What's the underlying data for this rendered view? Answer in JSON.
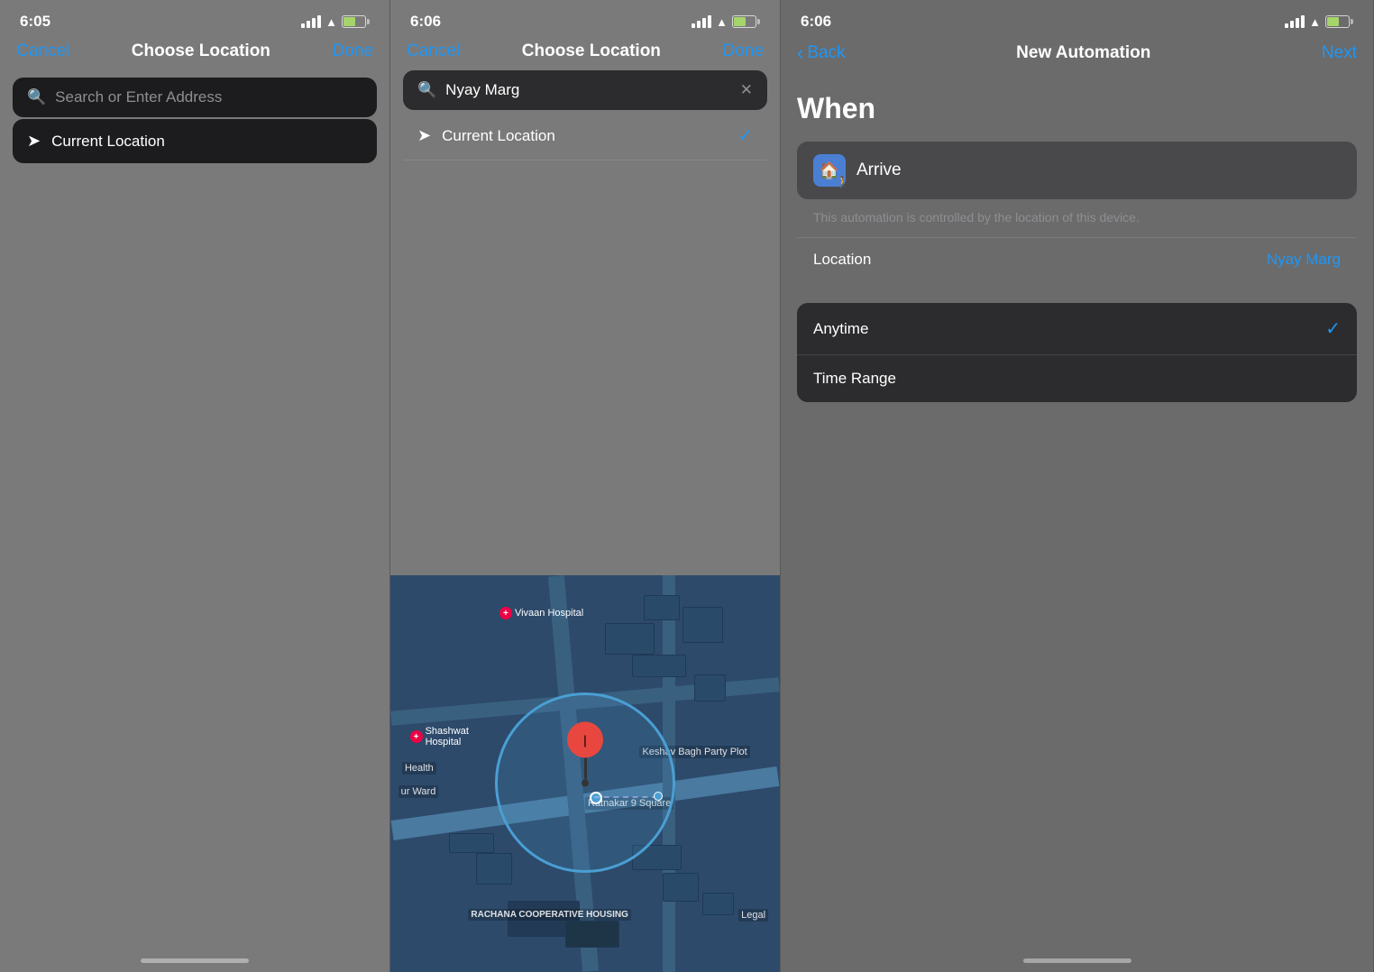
{
  "panel1": {
    "status_time": "6:05",
    "nav_cancel": "Cancel",
    "nav_title": "Choose Location",
    "nav_done": "Done",
    "search_placeholder": "Search or Enter Address",
    "current_location": "Current Location"
  },
  "panel2": {
    "status_time": "6:06",
    "nav_cancel": "Cancel",
    "nav_title": "Choose Location",
    "nav_done": "Done",
    "search_value": "Nyay Marg",
    "current_location": "Current Location",
    "map_labels": {
      "hospital1": "Vivaan Hospital",
      "hospital2": "Shashwat Hospital",
      "health": "Health",
      "ward": "ur Ward",
      "keshav": "Keshav Bagh Party Plot",
      "ratnakar": "Ratnakar 9 Square",
      "rachana": "RACHANA COOPERATIVE HOUSING",
      "legal": "Legal"
    }
  },
  "panel3": {
    "status_time": "6:06",
    "back_label": "Back",
    "title": "New Automation",
    "next_label": "Next",
    "when_heading": "When",
    "arrive_label": "Arrive",
    "automation_note": "This automation is controlled by the location of this device.",
    "location_label": "Location",
    "location_value": "Nyay Marg",
    "dropdown": {
      "anytime_label": "Anytime",
      "time_range_label": "Time Range"
    }
  }
}
